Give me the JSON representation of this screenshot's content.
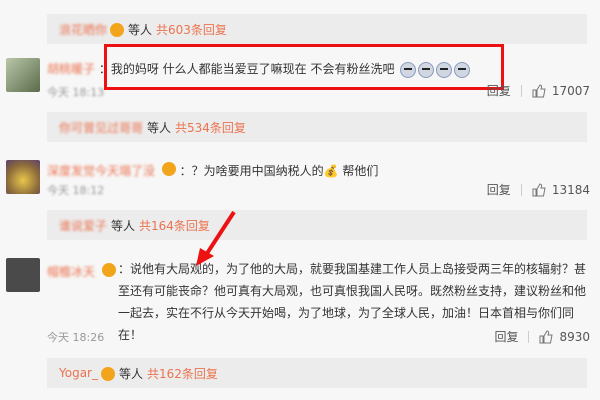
{
  "summaries": [
    {
      "user": "浪花晒你",
      "others": "等人",
      "count": "共603条回复"
    },
    {
      "user": "你可曾见过哥哥",
      "others": "等人",
      "count": "共534条回复"
    },
    {
      "user": "谁说爱子",
      "others": "等人",
      "count": "共164条回复"
    },
    {
      "user": "Yogar_",
      "others": "等人",
      "count": "共162条回复"
    }
  ],
  "comments": [
    {
      "user": "胡桃暖子",
      "text": "：我的妈呀 什么人都能当爱豆了嘛现在 不会有粉丝洗吧",
      "time": "今天 18:13",
      "reply_label": "回复",
      "likes": "17007"
    },
    {
      "user": "深度发觉今天塌了没",
      "text": "：？为啥要用中国纳税人的💰 帮他们",
      "time": "今天 18:12",
      "reply_label": "回复",
      "likes": "13184"
    },
    {
      "user": "帽檐冰天",
      "text": "：说他有大局观的，为了他的大局，就要我国基建工作人员上岛接受两三年的核辐射？甚至还有可能丧命？他可真有大局观，也可真恨我国人民呀。既然粉丝支持，建议粉丝和他一起去，实在不行从今天开始喝，为了地球，为了全球人民，加油！日本首相与你们同在！",
      "time": "今天 18:26",
      "reply_label": "回复",
      "likes": "8930"
    }
  ],
  "colors": {
    "accent": "#eb7350",
    "highlight": "#ee1111"
  }
}
